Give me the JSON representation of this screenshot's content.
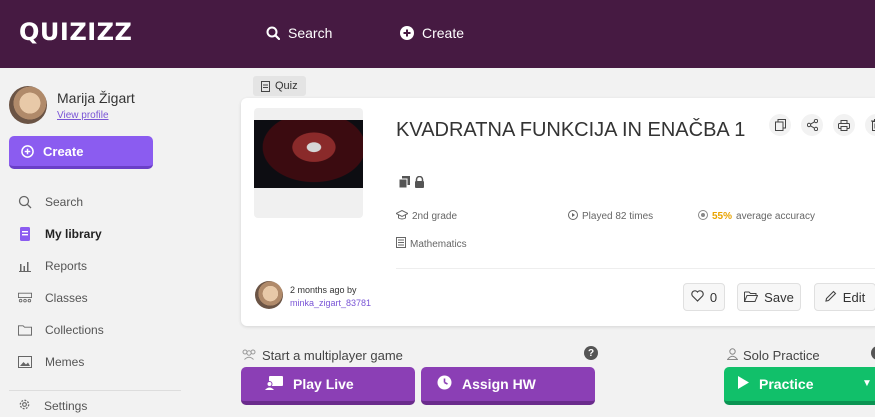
{
  "header": {
    "logo": "QUIZIZZ",
    "nav": {
      "search": "Search",
      "create": "Create"
    }
  },
  "sidebar": {
    "profile": {
      "name": "Marija Žigart",
      "link": "View profile"
    },
    "create_label": "Create",
    "items": [
      {
        "label": "Search",
        "icon": "search-icon"
      },
      {
        "label": "My library",
        "icon": "library-icon",
        "active": true
      },
      {
        "label": "Reports",
        "icon": "reports-icon"
      },
      {
        "label": "Classes",
        "icon": "classes-icon"
      },
      {
        "label": "Collections",
        "icon": "folder-icon"
      },
      {
        "label": "Memes",
        "icon": "image-icon"
      }
    ],
    "settings_label": "Settings"
  },
  "quiz": {
    "tag": "Quiz",
    "title": "KVADRATNA FUNKCIJA IN ENAČBA 1",
    "grade": "2nd grade",
    "played": "Played 82 times",
    "accuracy_value": "55%",
    "accuracy_label": "average accuracy",
    "subject": "Mathematics",
    "author_time": "2 months ago by",
    "author_name": "minka_zigart_83781",
    "likes": "0",
    "save_label": "Save",
    "edit_label": "Edit"
  },
  "actions": {
    "multiplayer_label": "Start a multiplayer game",
    "play_live": "Play Live",
    "assign_hw": "Assign HW",
    "solo_label": "Solo Practice",
    "practice": "Practice"
  },
  "colors": {
    "topbar": "#461a42",
    "primary_purple": "#8b5cf0",
    "button_purple": "#8b3fb5",
    "practice_green": "#11c06a",
    "accuracy_yellow": "#e9a400"
  }
}
